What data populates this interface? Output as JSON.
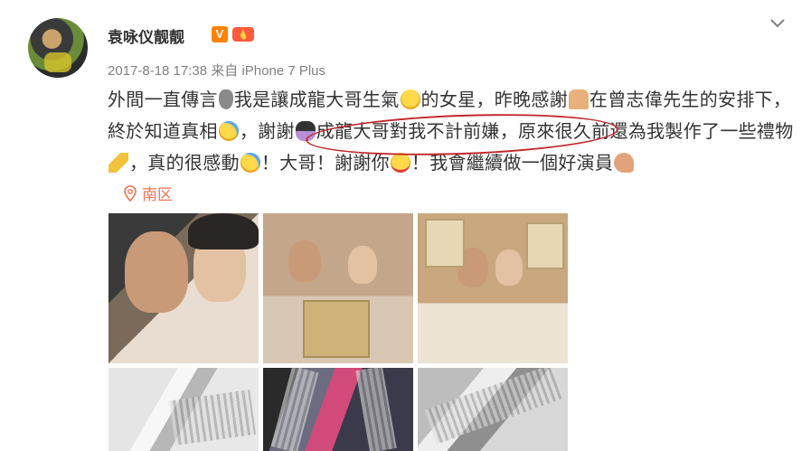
{
  "post": {
    "username": "袁咏仪靓靓",
    "verified_badge": "V",
    "timestamp": "2017-8-18 17:38",
    "source_prefix": "来自",
    "source": "iPhone 7 Plus",
    "text_segments": [
      "外間一直傳言",
      "我是讓成龍大哥生氣",
      "的女星，昨晚感謝",
      "在曾志偉先生的安排下，終於知道真相",
      "，謝謝",
      "成龍大哥對我不計前嫌，原來很久前還為我製作了一些禮物",
      "，真的很感動",
      "！大哥！謝謝你",
      "！我會繼續做一個好演員"
    ],
    "location": "南区"
  },
  "icons": {
    "avatar": "user-avatar",
    "verified": "verified-v-icon",
    "fire_badge": "fire-badge-icon",
    "expand": "chevron-down-icon",
    "location": "location-pin-icon",
    "emoji": [
      "speaking-head-icon",
      "angry-face-icon",
      "folded-hands-icon",
      "sad-tear-face-icon",
      "princess-icon",
      "ruler-icon",
      "sad-tear-face-icon",
      "heart-eyes-icon",
      "flexed-biceps-icon"
    ]
  },
  "colors": {
    "text": "#333333",
    "meta": "#808080",
    "location": "#eb7350",
    "badge": "#ff8200",
    "annotation_circle": "#c1272d"
  },
  "photos": [
    {
      "name": "photo-1"
    },
    {
      "name": "photo-2"
    },
    {
      "name": "photo-3"
    },
    {
      "name": "photo-4"
    },
    {
      "name": "photo-5"
    },
    {
      "name": "photo-6"
    }
  ]
}
